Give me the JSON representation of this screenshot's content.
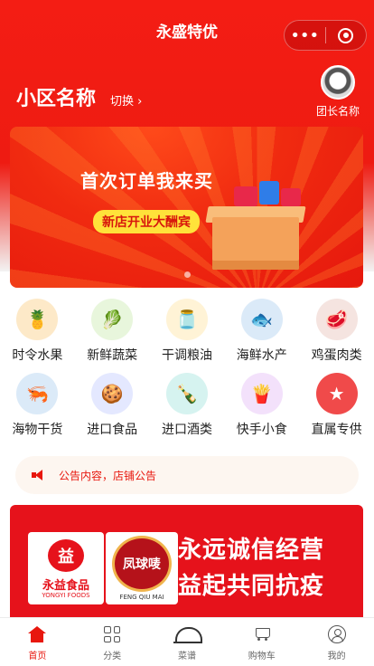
{
  "header": {
    "title": "永盛特优"
  },
  "capsule": {
    "more_label": "•••"
  },
  "community": {
    "name": "小区名称",
    "switch_label": "切换 ›"
  },
  "leader": {
    "name": "团长名称"
  },
  "banner": {
    "headline": "首次订单我来买",
    "tagline": "新店开业大酬宾"
  },
  "categories": [
    {
      "label": "时令水果",
      "icon": "pineapple-icon",
      "bg": "#fde9c8",
      "glyph": "🍍"
    },
    {
      "label": "新鲜蔬菜",
      "icon": "lettuce-icon",
      "bg": "#e8f6dc",
      "glyph": "🥬"
    },
    {
      "label": "干调粮油",
      "icon": "oil-bottle-icon",
      "bg": "#fff3d6",
      "glyph": "🫙"
    },
    {
      "label": "海鲜水产",
      "icon": "fish-icon",
      "bg": "#dbeaf8",
      "glyph": "🐟"
    },
    {
      "label": "鸡蛋肉类",
      "icon": "meat-icon",
      "bg": "#f5e4e0",
      "glyph": "🥩"
    },
    {
      "label": "海物干货",
      "icon": "dried-seafood-icon",
      "bg": "#dbeaf8",
      "glyph": "🦐"
    },
    {
      "label": "进口食品",
      "icon": "snack-box-icon",
      "bg": "#e4e8ff",
      "glyph": "🍪"
    },
    {
      "label": "进口酒类",
      "icon": "liquor-bottles-icon",
      "bg": "#d6f3f0",
      "glyph": "🍾"
    },
    {
      "label": "快手小食",
      "icon": "chips-bag-icon",
      "bg": "#f3e1fb",
      "glyph": "🍟"
    },
    {
      "label": "直属专供",
      "icon": "star-bookmark-icon",
      "bg": "#f04a4a",
      "glyph": "★"
    }
  ],
  "notice": {
    "text": "公告内容，店铺公告"
  },
  "promo": {
    "brand1": "永益食品",
    "brand1_en": "YONGYI FOODS",
    "brand2": "凤球唛",
    "brand2_en": "FENG QIU MAI",
    "slogan_line1": "永远诚信经营",
    "slogan_line2": "益起共同抗疫"
  },
  "tabs": [
    {
      "label": "首页",
      "active": true
    },
    {
      "label": "分类",
      "active": false
    },
    {
      "label": "菜谱",
      "active": false
    },
    {
      "label": "购物车",
      "active": false
    },
    {
      "label": "我的",
      "active": false
    }
  ],
  "colors": {
    "accent": "#e8170e",
    "promo_red": "#e6121b"
  }
}
